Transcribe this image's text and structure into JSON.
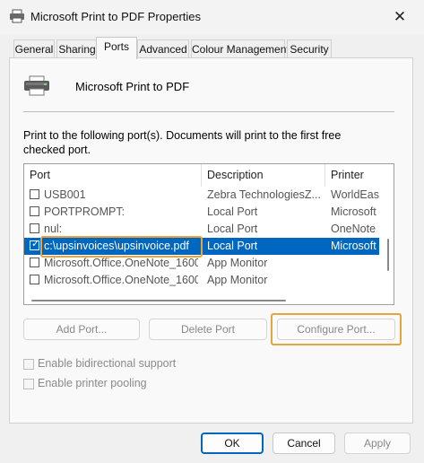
{
  "window": {
    "title": "Microsoft Print to PDF Properties",
    "close_glyph": "✕"
  },
  "tabs": [
    {
      "label": "General",
      "active": false
    },
    {
      "label": "Sharing",
      "active": false
    },
    {
      "label": "Ports",
      "active": true
    },
    {
      "label": "Advanced",
      "active": false
    },
    {
      "label": "Colour Management",
      "active": false
    },
    {
      "label": "Security",
      "active": false
    }
  ],
  "printer": {
    "name": "Microsoft Print to PDF",
    "icon": "printer-icon"
  },
  "instructions": "Print to the following port(s). Documents will print to the first free checked port.",
  "port_list": {
    "columns": [
      "Port",
      "Description",
      "Printer"
    ],
    "rows": [
      {
        "port": "USB001",
        "description": "Zebra TechnologiesZ...",
        "printer": "WorldEase",
        "checked": false,
        "selected": false
      },
      {
        "port": "PORTPROMPT:",
        "description": "Local Port",
        "printer": "Microsoft",
        "checked": false,
        "selected": false
      },
      {
        "port": "nul:",
        "description": "Local Port",
        "printer": "OneNote",
        "checked": false,
        "selected": false
      },
      {
        "port": "c:\\upsinvoices\\upsinvoice.pdf",
        "description": "Local Port",
        "printer": "Microsoft",
        "checked": true,
        "selected": true
      },
      {
        "port": "Microsoft.Office.OneNote_1600...",
        "description": "App Monitor",
        "printer": "",
        "checked": false,
        "selected": false
      },
      {
        "port": "Microsoft.Office.OneNote_1600...",
        "description": "App Monitor",
        "printer": "",
        "checked": false,
        "selected": false
      }
    ]
  },
  "port_buttons": {
    "add": "Add Port...",
    "delete": "Delete Port",
    "configure": "Configure Port..."
  },
  "options": {
    "bidirectional": "Enable bidirectional support",
    "pooling": "Enable printer pooling"
  },
  "footer": {
    "ok": "OK",
    "cancel": "Cancel",
    "apply": "Apply"
  },
  "colors": {
    "accent": "#0067c0",
    "highlight": "#e8a33a"
  }
}
